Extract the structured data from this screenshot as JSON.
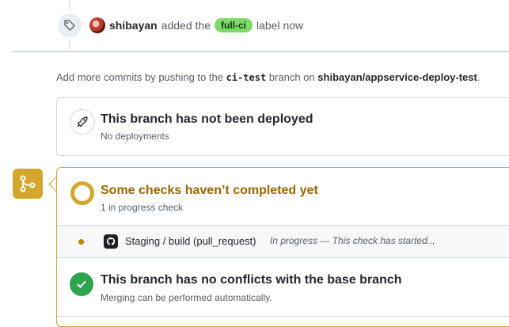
{
  "event": {
    "actor": "shibayan",
    "action_text": "added the",
    "label": "full-ci",
    "trailing_text": "label now"
  },
  "hint": {
    "prefix": "Add more commits by pushing to the",
    "branch": "ci-test",
    "middle": "branch on",
    "repo": "shibayan/appservice-deploy-test",
    "suffix": "."
  },
  "deploy": {
    "title": "This branch has not been deployed",
    "subtitle": "No deployments"
  },
  "checks": {
    "title": "Some checks haven’t completed yet",
    "subtitle": "1 in progress check",
    "items": [
      {
        "name": "Staging / build (pull_request)",
        "status": "In progress — This check has started..."
      }
    ]
  },
  "conflicts": {
    "title": "This branch has no conflicts with the base branch",
    "subtitle": "Merging can be performed automatically."
  },
  "colors": {
    "pending": "#d4a72c",
    "success": "#2da44e",
    "label_bg": "#7fd96a"
  },
  "icons": [
    "tag-icon",
    "rocket-icon",
    "git-merge-icon",
    "github-icon",
    "check-icon"
  ]
}
